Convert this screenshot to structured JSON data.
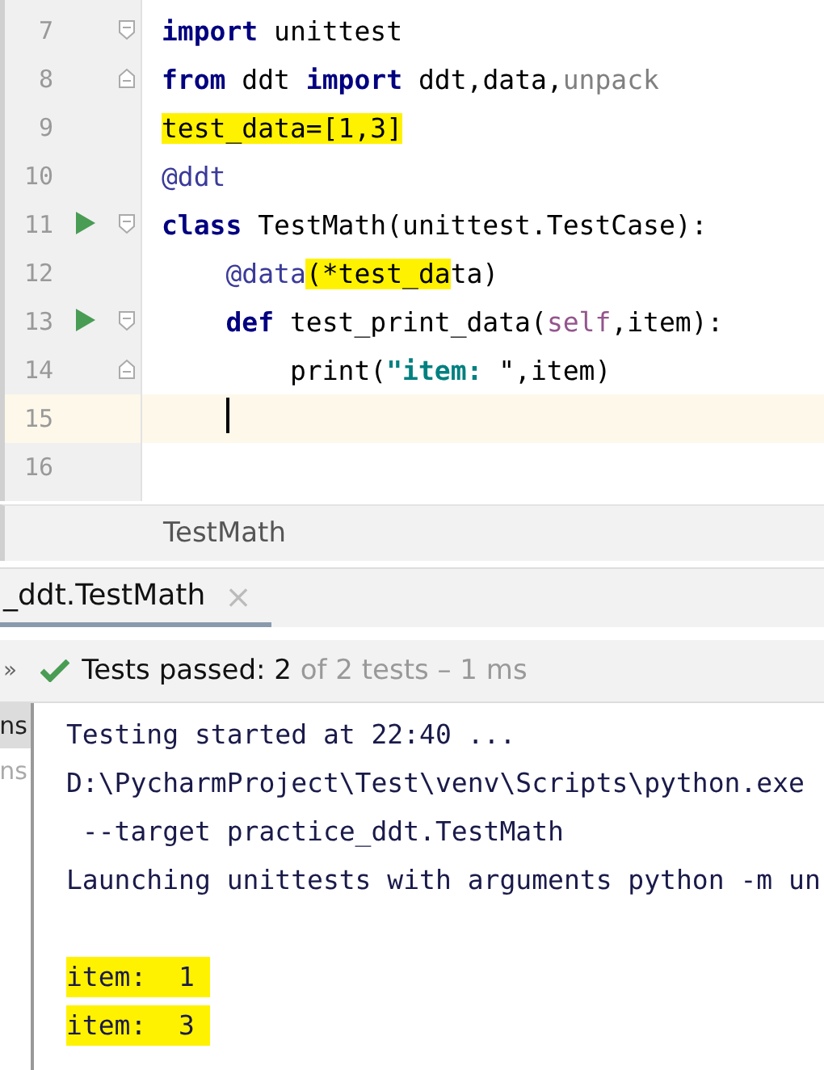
{
  "editor": {
    "lines": [
      {
        "number": "7",
        "fold_top": true,
        "fold_bottom": false,
        "run": false,
        "current": false,
        "tokens": [
          {
            "text": "import",
            "kind": "keyword"
          },
          {
            "text": " unittest",
            "kind": "plain"
          }
        ]
      },
      {
        "number": "8",
        "fold_top": false,
        "fold_bottom": true,
        "run": false,
        "current": false,
        "tokens": [
          {
            "text": "from",
            "kind": "keyword"
          },
          {
            "text": " ddt ",
            "kind": "plain"
          },
          {
            "text": "import",
            "kind": "keyword"
          },
          {
            "text": " ddt,data,",
            "kind": "plain"
          },
          {
            "text": "unpack",
            "kind": "unused"
          }
        ]
      },
      {
        "number": "9",
        "fold_top": false,
        "fold_bottom": false,
        "run": false,
        "current": false,
        "tokens": [
          {
            "text": "test_data=[1,3]",
            "kind": "plain",
            "marked": true
          }
        ]
      },
      {
        "number": "10",
        "fold_top": false,
        "fold_bottom": false,
        "run": false,
        "current": false,
        "tokens": [
          {
            "text": "@ddt",
            "kind": "decorator"
          }
        ]
      },
      {
        "number": "11",
        "fold_top": true,
        "fold_bottom": false,
        "run": true,
        "current": false,
        "tokens": [
          {
            "text": "class",
            "kind": "keyword"
          },
          {
            "text": " TestMath(unittest.TestCase):",
            "kind": "plain"
          }
        ]
      },
      {
        "number": "12",
        "fold_top": false,
        "fold_bottom": false,
        "run": false,
        "current": false,
        "tokens": [
          {
            "text": "    @data",
            "kind": "decorator"
          },
          {
            "text": "(*test_da",
            "kind": "plain",
            "marked": true
          },
          {
            "text": "ta)",
            "kind": "plain"
          }
        ]
      },
      {
        "number": "13",
        "fold_top": true,
        "fold_bottom": false,
        "run": true,
        "current": false,
        "tokens": [
          {
            "text": "    def",
            "kind": "keyword"
          },
          {
            "text": " test_print_data(",
            "kind": "plain"
          },
          {
            "text": "self",
            "kind": "self"
          },
          {
            "text": ",item):",
            "kind": "plain"
          }
        ]
      },
      {
        "number": "14",
        "fold_top": false,
        "fold_bottom": true,
        "run": false,
        "current": false,
        "tokens": [
          {
            "text": "        print(",
            "kind": "plain"
          },
          {
            "text": "\"item: ",
            "kind": "string"
          },
          {
            "text": "\",item)",
            "kind": "plain"
          }
        ]
      },
      {
        "number": "15",
        "fold_top": false,
        "fold_bottom": false,
        "run": false,
        "current": true,
        "cursor": true
      },
      {
        "number": "16",
        "fold_top": false,
        "fold_bottom": false,
        "run": false,
        "current": false
      }
    ]
  },
  "breadcrumb": "TestMath",
  "run_tab": {
    "label": "_ddt.TestMath",
    "close": "×"
  },
  "status": {
    "chevron": "»",
    "passed": "Tests passed: 2",
    "rest": "of 2 tests – 1 ms"
  },
  "side_items": [
    {
      "text": "ns",
      "selected": true
    },
    {
      "text": "ns",
      "selected": false
    }
  ],
  "console": {
    "log": [
      "Testing started at 22:40 ...",
      "D:\\PycharmProject\\Test\\venv\\Scripts\\python.exe",
      " --target practice_ddt.TestMath",
      "Launching unittests with arguments python -m un"
    ],
    "output": [
      "item:  1",
      "item:  3"
    ]
  }
}
